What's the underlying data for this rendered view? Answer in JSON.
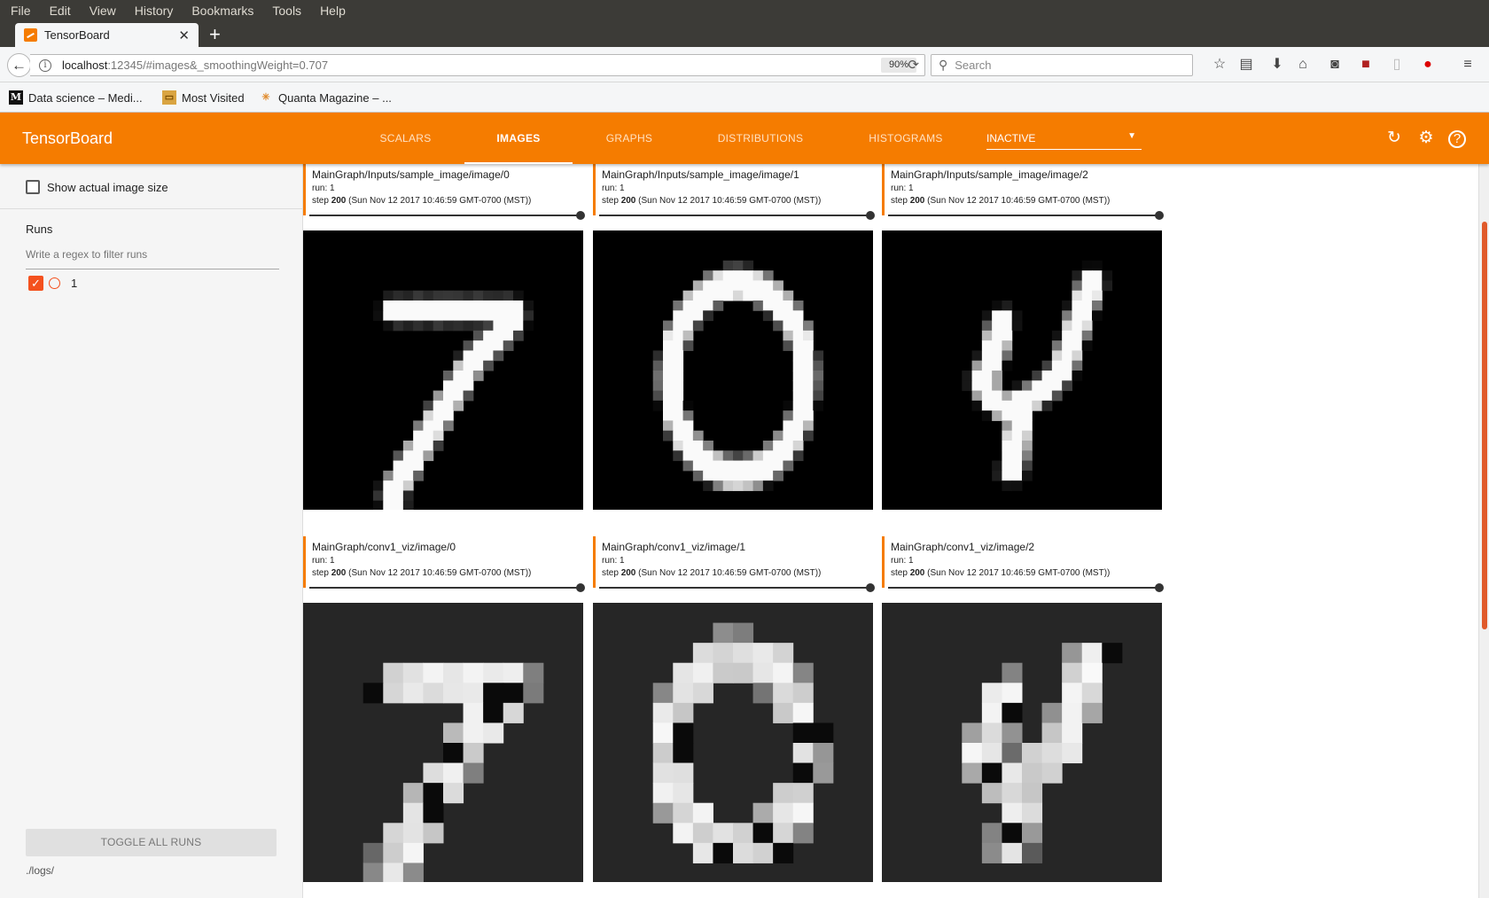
{
  "menubar": [
    "File",
    "Edit",
    "View",
    "History",
    "Bookmarks",
    "Tools",
    "Help"
  ],
  "browser": {
    "tab_title": "TensorBoard",
    "url_host": "localhost",
    "url_path": ":12345/#images&_smoothingWeight=0.707",
    "zoom": "90%",
    "search_placeholder": "Search",
    "bookmarks": [
      "Data science – Medi...",
      "Most Visited",
      "Quanta Magazine – ..."
    ]
  },
  "tensorboard": {
    "title": "TensorBoard",
    "tabs": [
      "SCALARS",
      "IMAGES",
      "GRAPHS",
      "DISTRIBUTIONS",
      "HISTOGRAMS"
    ],
    "active_tab": "IMAGES",
    "inactive_label": "INACTIVE"
  },
  "sidebar": {
    "show_actual_size": "Show actual image size",
    "runs_title": "Runs",
    "filter_placeholder": "Write a regex to filter runs",
    "run_name": "1",
    "toggle_all": "TOGGLE ALL RUNS",
    "logdir": "./logs/"
  },
  "cards": [
    {
      "tag": "MainGraph/Inputs/sample_image/image/0",
      "run": "run: 1",
      "step_value": "200",
      "step_time": "(Sun Nov 12 2017 10:46:59 GMT-0700 (MST))"
    },
    {
      "tag": "MainGraph/Inputs/sample_image/image/1",
      "run": "run: 1",
      "step_value": "200",
      "step_time": "(Sun Nov 12 2017 10:46:59 GMT-0700 (MST))"
    },
    {
      "tag": "MainGraph/Inputs/sample_image/image/2",
      "run": "run: 1",
      "step_value": "200",
      "step_time": "(Sun Nov 12 2017 10:46:59 GMT-0700 (MST))"
    },
    {
      "tag": "MainGraph/conv1_viz/image/0",
      "run": "run: 1",
      "step_value": "200",
      "step_time": "(Sun Nov 12 2017 10:46:59 GMT-0700 (MST))"
    },
    {
      "tag": "MainGraph/conv1_viz/image/1",
      "run": "run: 1",
      "step_value": "200",
      "step_time": "(Sun Nov 12 2017 10:46:59 GMT-0700 (MST))"
    },
    {
      "tag": "MainGraph/conv1_viz/image/2",
      "run": "run: 1",
      "step_value": "200",
      "step_time": "(Sun Nov 12 2017 10:46:59 GMT-0700 (MST))"
    }
  ],
  "step_label": "step",
  "colors": {
    "accent": "#f57c00",
    "run_color": "#f4511e"
  }
}
